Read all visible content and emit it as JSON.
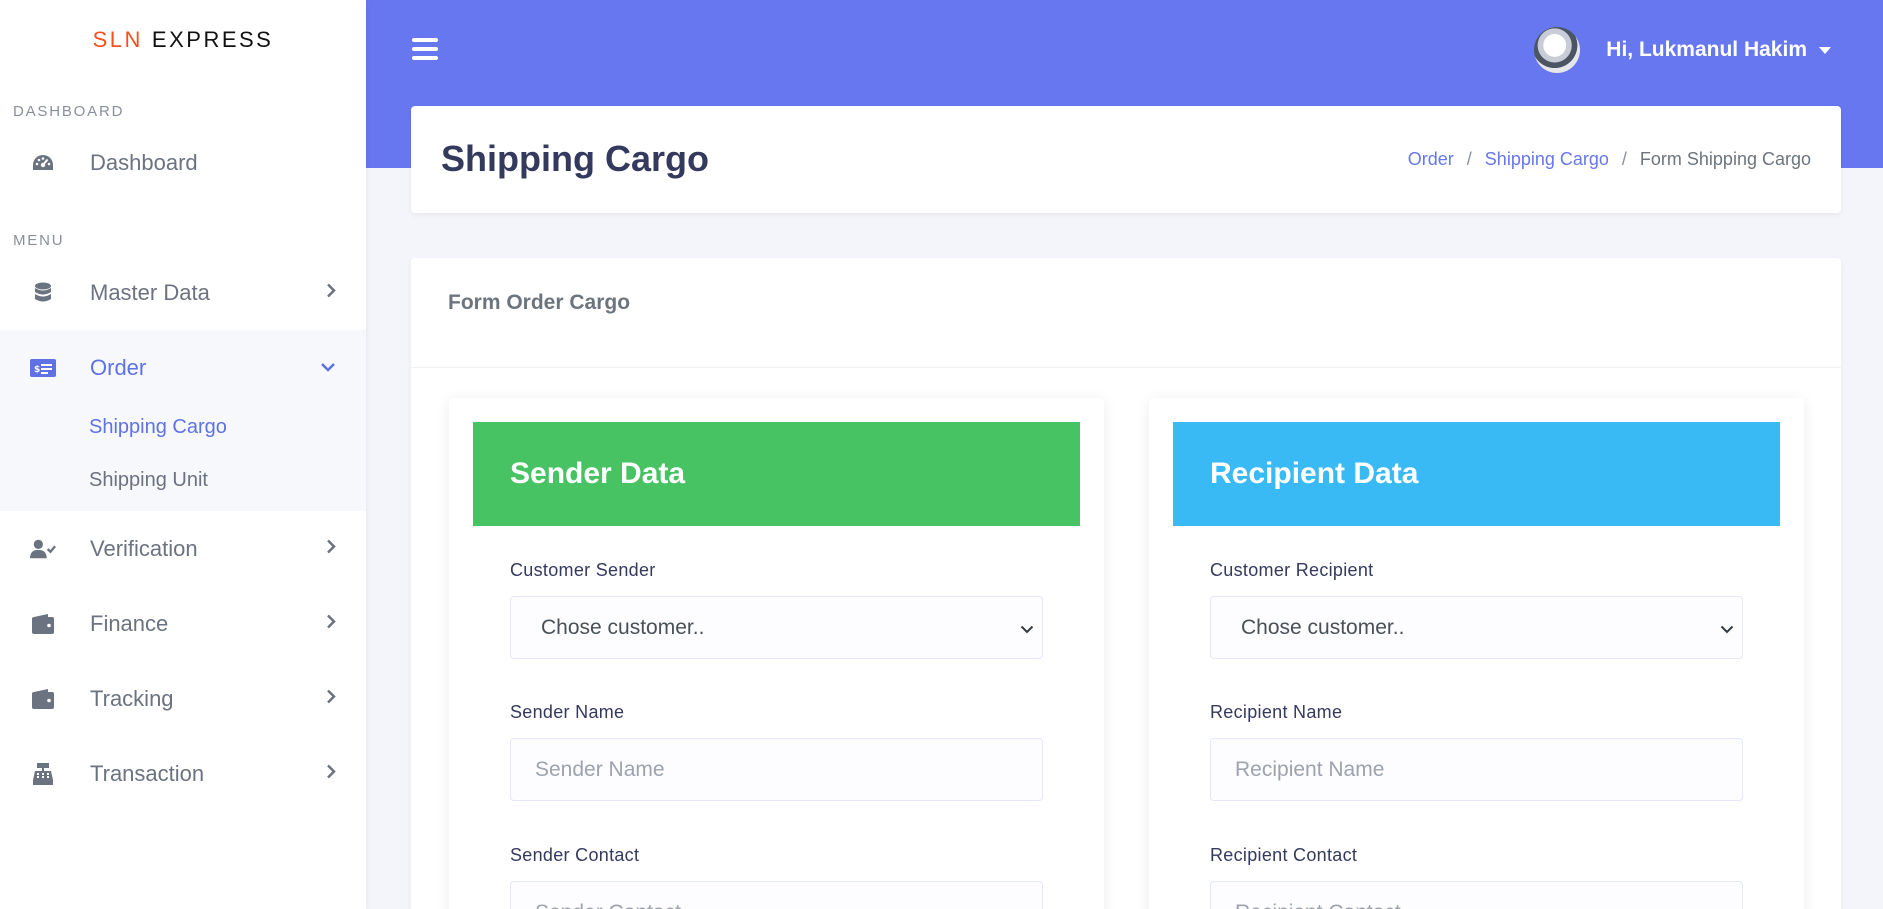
{
  "brand": {
    "part1": "SLN",
    "part2": "EXPRESS"
  },
  "sidebar": {
    "section_dashboard": "DASHBOARD",
    "section_menu": "MENU",
    "dashboard": {
      "label": "Dashboard",
      "icon": "gauge-icon"
    },
    "master_data": {
      "label": "Master Data",
      "icon": "database-icon"
    },
    "order": {
      "label": "Order",
      "icon": "money-card-icon",
      "sub": [
        {
          "label": "Shipping Cargo"
        },
        {
          "label": "Shipping Unit"
        }
      ]
    },
    "verification": {
      "label": "Verification",
      "icon": "user-check-icon"
    },
    "finance": {
      "label": "Finance",
      "icon": "wallet-icon"
    },
    "tracking": {
      "label": "Tracking",
      "icon": "wallet-icon"
    },
    "transaction": {
      "label": "Transaction",
      "icon": "cash-register-icon"
    }
  },
  "topbar": {
    "user_name": "Hi, Lukmanul Hakim"
  },
  "header": {
    "title": "Shipping Cargo",
    "breadcrumb": [
      "Order",
      "Shipping Cargo",
      "Form Shipping Cargo"
    ]
  },
  "form": {
    "title": "Form Order Cargo",
    "sender": {
      "title": "Sender Data",
      "customer_label": "Customer Sender",
      "customer_value": "Chose customer..",
      "name_label": "Sender Name",
      "name_placeholder": "Sender Name",
      "contact_label": "Sender Contact",
      "contact_placeholder": "Sender Contact"
    },
    "recipient": {
      "title": "Recipient Data",
      "customer_label": "Customer Recipient",
      "customer_value": "Chose customer..",
      "name_label": "Recipient Name",
      "name_placeholder": "Recipient Name",
      "contact_label": "Recipient Contact",
      "contact_placeholder": "Recipient Contact"
    }
  },
  "colors": {
    "primary": "#6777ef",
    "sender_header": "#47c363",
    "recipient_header": "#3abaf4",
    "brand_accent": "#f4511e"
  }
}
